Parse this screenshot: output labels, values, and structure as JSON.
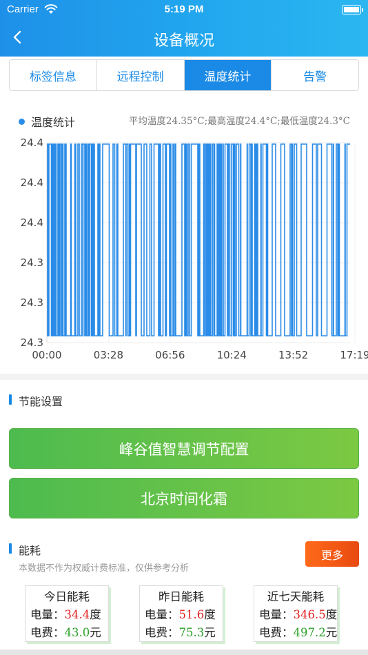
{
  "status_bar": {
    "carrier": "Carrier",
    "time": "5:19 PM"
  },
  "nav": {
    "title": "设备概况"
  },
  "tabs": [
    {
      "label": "标签信息",
      "active": false
    },
    {
      "label": "远程控制",
      "active": false
    },
    {
      "label": "温度统计",
      "active": true
    },
    {
      "label": "告警",
      "active": false
    }
  ],
  "chart": {
    "legend": "温度统计",
    "summary": "平均温度24.35°C;最高温度24.4°C;最低温度24.3°C"
  },
  "chart_data": {
    "type": "line",
    "series": [
      {
        "name": "温度统计",
        "color": "#2a8ce8"
      }
    ],
    "x_tick_labels": [
      "00:00",
      "03:28",
      "06:56",
      "10:24",
      "13:52",
      "17:19"
    ],
    "y_tick_labels": [
      "24.4",
      "24.4",
      "24.4",
      "24.3",
      "24.3",
      "24.3"
    ],
    "ylim": [
      24.3,
      24.4
    ],
    "grid": true,
    "legend_position": "top-left",
    "toggle_density": [
      [
        0.0,
        0.14,
        0.55
      ],
      [
        0.14,
        0.33,
        0.35
      ],
      [
        0.33,
        0.4,
        0.2
      ],
      [
        0.4,
        0.52,
        0.3
      ],
      [
        0.52,
        0.6,
        0.92
      ],
      [
        0.6,
        0.67,
        0.35
      ],
      [
        0.67,
        0.82,
        0.3
      ],
      [
        0.82,
        1.0,
        0.22
      ]
    ]
  },
  "energy_settings": {
    "title": "节能设置",
    "buttons": [
      "峰谷值智慧调节配置",
      "北京时间化霜"
    ]
  },
  "energy": {
    "title": "能耗",
    "note": "本数据不作为权威计费标准，仅供参考分析",
    "more": "更多",
    "cards": [
      {
        "title": "今日能耗",
        "power_label": "电量：",
        "power": "34.4",
        "power_unit": "度",
        "fee_label": "电费：",
        "fee": "43.0",
        "fee_unit": "元"
      },
      {
        "title": "昨日能耗",
        "power_label": "电量：",
        "power": "51.6",
        "power_unit": "度",
        "fee_label": "电费：",
        "fee": "75.3",
        "fee_unit": "元"
      },
      {
        "title": "近七天能耗",
        "power_label": "电量：",
        "power": "346.5",
        "power_unit": "度",
        "fee_label": "电费：",
        "fee": "497.2",
        "fee_unit": "元"
      }
    ]
  },
  "icons": {
    "back": "chevron-left-icon",
    "wifi": "wifi-icon",
    "battery": "battery-icon"
  }
}
